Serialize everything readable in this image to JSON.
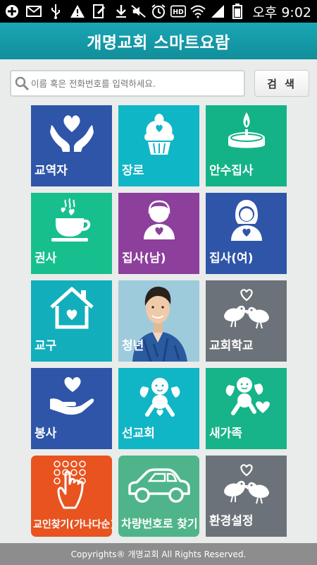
{
  "status_bar": {
    "time": "오후 9:02",
    "icons": [
      "plus-icon",
      "mail-icon",
      "usb-icon",
      "warning-icon",
      "edit-icon",
      "download-icon",
      "mute-icon",
      "alarm-icon",
      "hd-icon",
      "wifi-icon",
      "signal-icon",
      "battery-icon"
    ]
  },
  "app": {
    "title": "개명교회 스마트요람"
  },
  "search": {
    "placeholder": "이름 혹은 전화번호를 입력하세요.",
    "button_label": "검 색"
  },
  "tiles": [
    {
      "label": "교역자",
      "color": "#2e55a8",
      "icon": "hands-heart-icon"
    },
    {
      "label": "장로",
      "color": "#0fb6c6",
      "icon": "cupcake-heart-icon"
    },
    {
      "label": "안수집사",
      "color": "#14b387",
      "icon": "candle-icon"
    },
    {
      "label": "권사",
      "color": "#18bf8e",
      "icon": "coffee-cup-hearts-icon"
    },
    {
      "label": "집사(남)",
      "color": "#8d3f9c",
      "icon": "man-heart-icon"
    },
    {
      "label": "집사(여)",
      "color": "#2e55a8",
      "icon": "woman-heart-icon"
    },
    {
      "label": "교구",
      "color": "#12aebc",
      "icon": "house-heart-icon"
    },
    {
      "label": "청년",
      "color": "#7fb6cc",
      "icon": "young-man-photo"
    },
    {
      "label": "교회학교",
      "color": "#6c7279",
      "icon": "love-birds-icon"
    },
    {
      "label": "봉사",
      "color": "#2e55a8",
      "icon": "hand-heart-icon"
    },
    {
      "label": "선교회",
      "color": "#10b6c6",
      "icon": "cupid-icon"
    },
    {
      "label": "새가족",
      "color": "#16b488",
      "icon": "cupid-heart-icon"
    },
    {
      "label": "교인찾기(가나다순)",
      "color": "#e8531f",
      "icon": "keypad-hand-icon"
    },
    {
      "label": "차량번호로 찾기",
      "color": "#4fb48a",
      "icon": "car-icon"
    },
    {
      "label": "환경설정",
      "color": "#6c7279",
      "icon": "love-birds-icon"
    }
  ],
  "footer": {
    "text": "Copyrights® 개명교회 All Rights Reserved."
  }
}
